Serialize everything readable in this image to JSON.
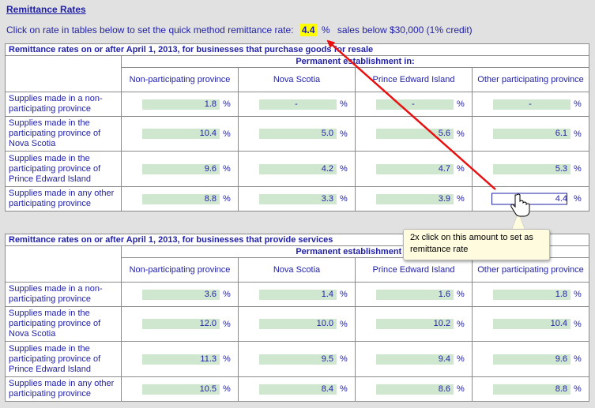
{
  "header": {
    "title": "Remittance Rates",
    "intro_text": "Click on rate in tables below to set the quick method remittance rate:",
    "rate_value": "4.4",
    "rate_unit": "%",
    "rate_note": "sales below $30,000 (1% credit)"
  },
  "goods_table": {
    "title": "Remittance rates on or after April 1, 2013, for businesses that purchase goods for resale",
    "perm_label": "Permanent establishment in:",
    "columns": [
      "Non-participating province",
      "Nova Scotia",
      "Prince Edward Island",
      "Other participating province"
    ],
    "rows": [
      {
        "label": "Supplies made in a non-participating province",
        "values": [
          "1.8",
          "-",
          "-",
          "-"
        ]
      },
      {
        "label": "Supplies made in the participating province of Nova Scotia",
        "values": [
          "10.4",
          "5.0",
          "5.6",
          "6.1"
        ]
      },
      {
        "label": "Supplies made in the participating province of Prince Edward Island",
        "values": [
          "9.6",
          "4.2",
          "4.7",
          "5.3"
        ]
      },
      {
        "label": "Supplies made in any other participating province",
        "values": [
          "8.8",
          "3.3",
          "3.9",
          "4.4"
        ]
      }
    ],
    "unit": "%"
  },
  "services_table": {
    "title": "Remittance rates on or after April 1, 2013, for businesses that provide services",
    "perm_label": "Permanent establishment in:",
    "columns": [
      "Non-participating province",
      "Nova Scotia",
      "Prince Edward Island",
      "Other participating province"
    ],
    "rows": [
      {
        "label": "Supplies made in a non-participating province",
        "values": [
          "3.6",
          "1.4",
          "1.6",
          "1.8"
        ]
      },
      {
        "label": "Supplies made in the participating province of Nova Scotia",
        "values": [
          "12.0",
          "10.0",
          "10.2",
          "10.4"
        ]
      },
      {
        "label": "Supplies made in the participating province of Prince Edward Island",
        "values": [
          "11.3",
          "9.5",
          "9.4",
          "9.6"
        ]
      },
      {
        "label": "Supplies made in any other participating province",
        "values": [
          "10.5",
          "8.4",
          "8.6",
          "8.8"
        ]
      }
    ],
    "unit": "%"
  },
  "callout": {
    "text": "2x click on this amount to set as remittance rate"
  },
  "icons": {
    "pointer": "hand-pointer-icon",
    "arrow": "red-arrow-icon"
  },
  "colors": {
    "text": "#1f1fa8",
    "value_fill": "#cfe6cf",
    "highlight": "#ffff00",
    "arrow": "#e81010",
    "callout_bg": "#fffbdf"
  }
}
